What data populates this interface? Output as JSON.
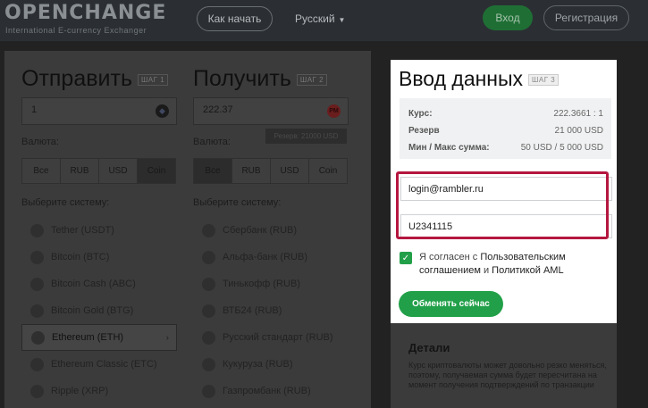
{
  "header": {
    "logo": "OPENCHANGE",
    "logo_sub": "International E-currency Exchanger",
    "how_to_start": "Как начать",
    "language": "Русский",
    "login": "Вход",
    "register": "Регистрация"
  },
  "send": {
    "title": "Отправить",
    "step": "ШАГ 1",
    "amount": "1",
    "currency_label": "Валюта:",
    "tabs": [
      "Все",
      "RUB",
      "USD",
      "Coin"
    ],
    "active_tab": "Coin",
    "system_label": "Выберите систему:",
    "systems": [
      "Tether (USDT)",
      "Bitcoin (BTC)",
      "Bitcoin Cash (ABC)",
      "Bitcoin Gold (BTG)",
      "Ethereum (ETH)",
      "Ethereum Classic (ETC)",
      "Ripple (XRP)"
    ],
    "selected_system": "Ethereum (ETH)"
  },
  "receive": {
    "title": "Получить",
    "step": "ШАГ 2",
    "amount": "222.37",
    "coin_badge": "PM",
    "reserve_tip": "Резерв: 21000 USD",
    "currency_label": "Валюта:",
    "tabs": [
      "Все",
      "RUB",
      "USD",
      "Coin"
    ],
    "active_tab": "Все",
    "system_label": "Выберите систему:",
    "systems": [
      "Сбербанк (RUB)",
      "Альфа-банк (RUB)",
      "Тинькофф (RUB)",
      "ВТБ24 (RUB)",
      "Русский стандарт (RUB)",
      "Кукуруза (RUB)",
      "Газпромбанк (RUB)"
    ]
  },
  "form": {
    "title": "Ввод данных",
    "step": "ШАГ 3",
    "rate_label": "Курс:",
    "rate_value": "222.3661 : 1",
    "reserve_label": "Резерв",
    "reserve_value": "21 000 USD",
    "minmax_label": "Мин / Макс сумма:",
    "minmax_value": "50 USD / 5 000 USD",
    "email_value": "login@rambler.ru",
    "wallet_value": "U2341115",
    "agree_prefix": "Я согласен с ",
    "agree_link1": "Пользовательским соглашением",
    "agree_and": " и ",
    "agree_link2": "Политикой AML",
    "exchange_button": "Обменять сейчас"
  },
  "details": {
    "title": "Детали",
    "text": "Курс криптовалюты может довольно резко меняться, поэтому, получаемая сумма будет пересчитана на момент получения подтверждений по транзакции"
  },
  "colors": {
    "accent_green": "#22a049",
    "highlight_red": "#b4173f"
  }
}
